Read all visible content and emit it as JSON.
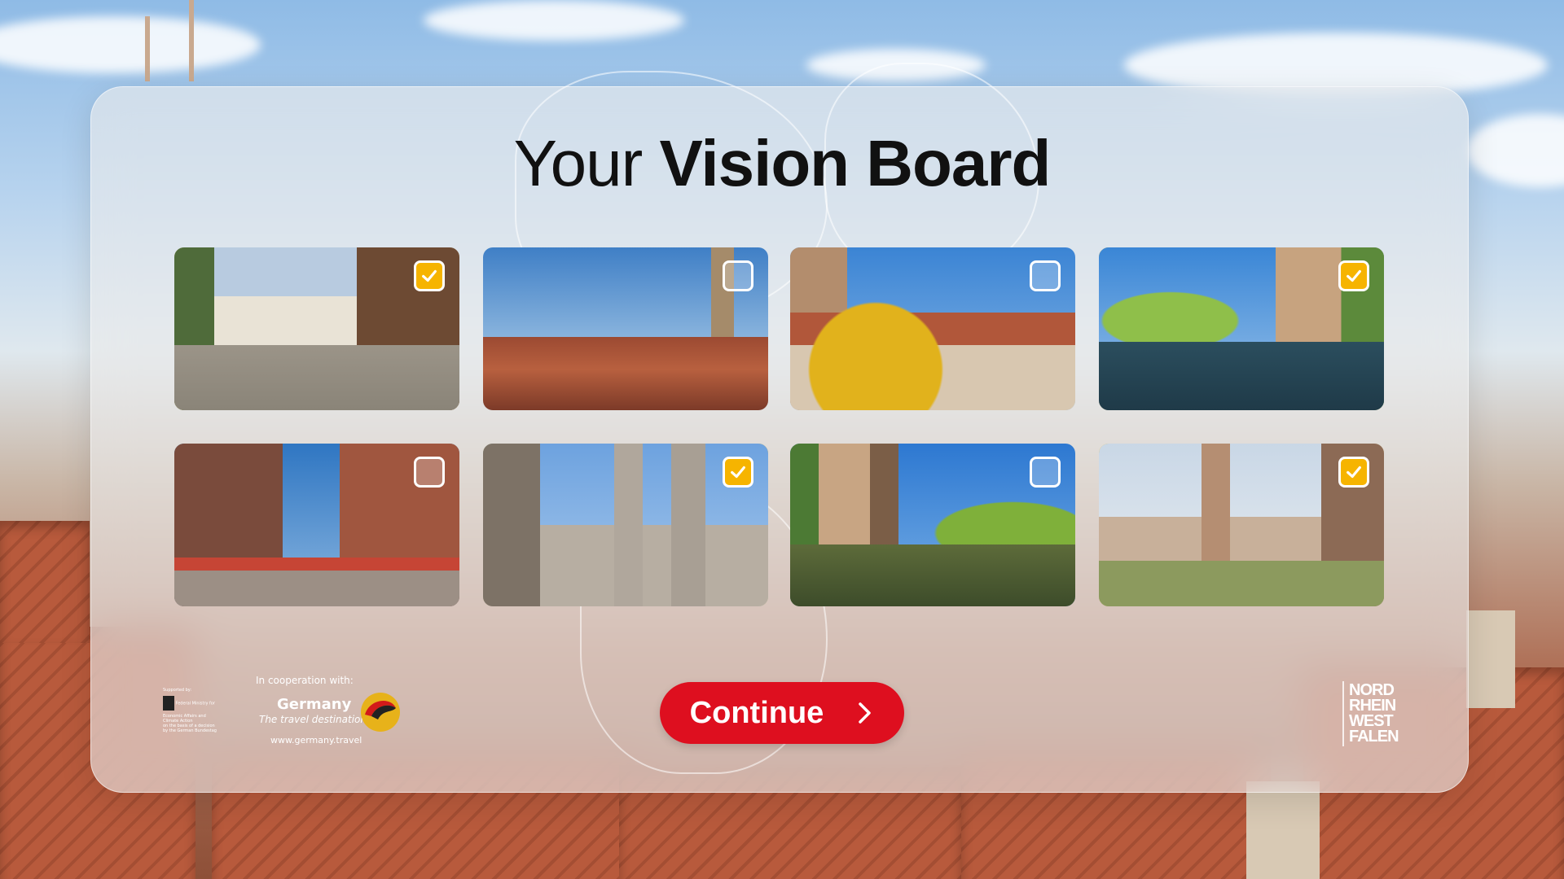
{
  "title": {
    "light": "Your",
    "bold": "Vision Board"
  },
  "tiles": [
    {
      "scene": "old-town-square-half-timbered",
      "selected": true
    },
    {
      "scene": "city-skyline-church-spires",
      "selected": false
    },
    {
      "scene": "castle-autumn-tree-rooftops",
      "selected": false
    },
    {
      "scene": "river-bridge-willow-reflection",
      "selected": true
    },
    {
      "scene": "frauenkirche-market-square",
      "selected": false
    },
    {
      "scene": "st-lorenz-church-towers",
      "selected": true
    },
    {
      "scene": "henkersteg-river-willow",
      "selected": false
    },
    {
      "scene": "castle-tower-courtyard",
      "selected": true
    }
  ],
  "continue_label": "Continue",
  "footer": {
    "sponsor_line1": "Supported by:",
    "sponsor_line2": "Federal Ministry for Economic Affairs and Climate Action",
    "sponsor_line3": "on the basis of a decision by the German Bundestag",
    "coop_label": "In cooperation with:",
    "germany_name": "Germany",
    "germany_tagline": "The travel destination",
    "germany_url": "www.germany.travel",
    "nrw_lines": [
      "NORD",
      "RHEIN",
      "WEST",
      "FALEN"
    ]
  },
  "colors": {
    "accent": "#de0f1f",
    "selected": "#f5b700"
  },
  "icons": {
    "check": "checkmark-icon",
    "arrow": "chevron-right-icon"
  }
}
